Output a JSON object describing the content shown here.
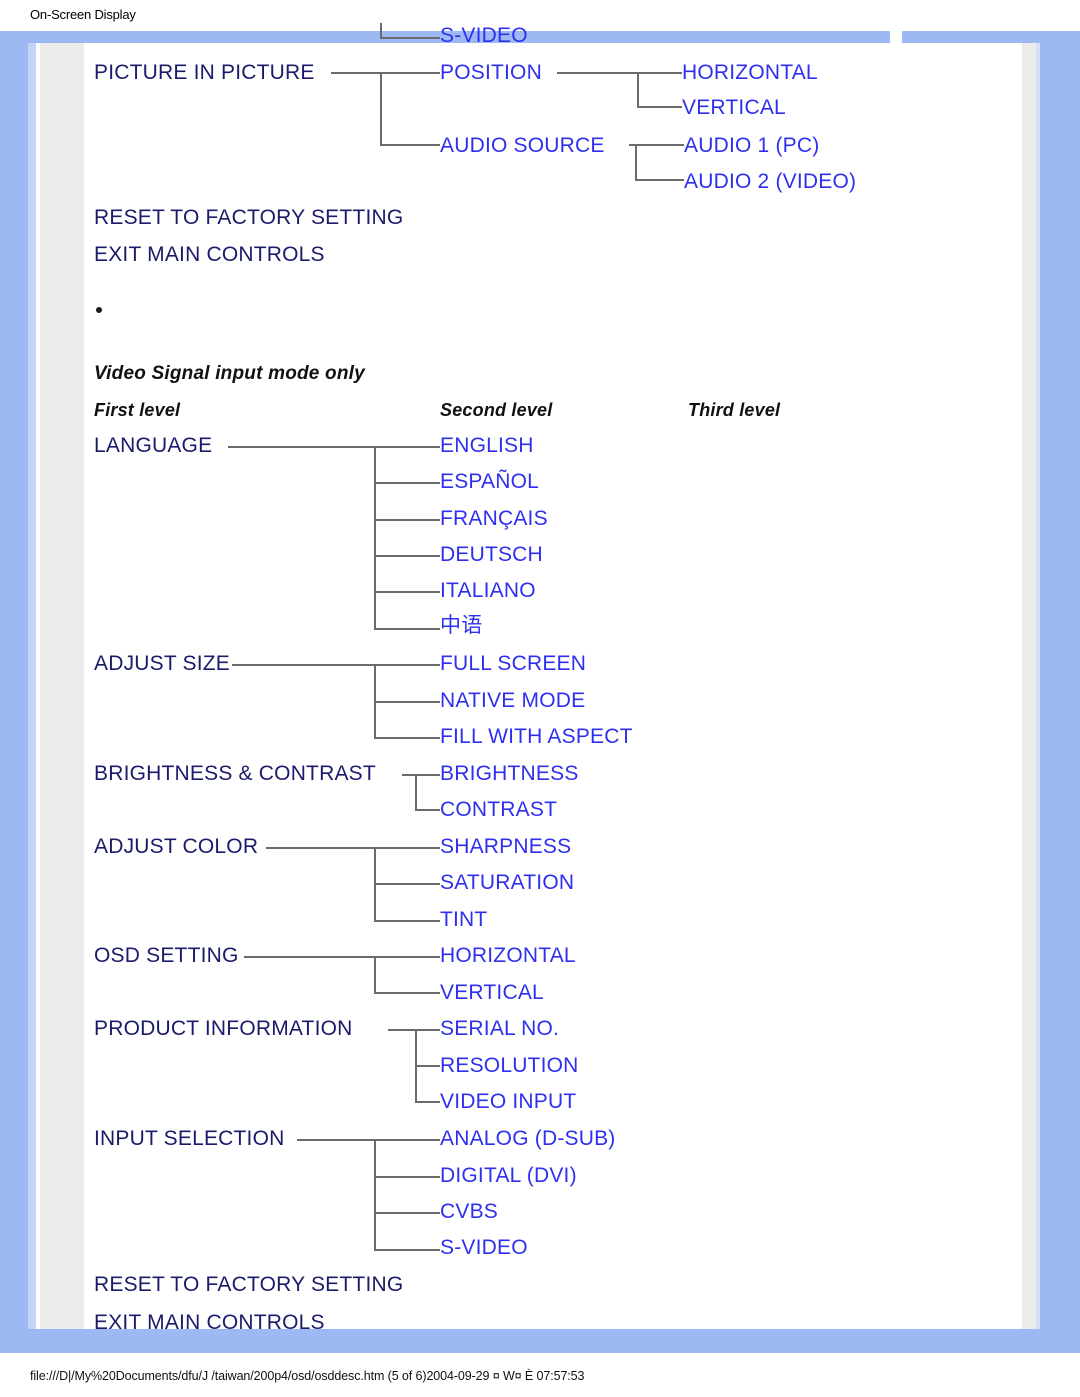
{
  "page": {
    "header_title": "On-Screen Display",
    "footer_text": "file:///D|/My%20Documents/dfu/J /taiwan/200p4/osd/osddesc.htm (5 of 6)2004-09-29 ¤ W¤ È 07:57:53",
    "colors": {
      "frame_blue": "#9db8f2",
      "frame_light_blue": "#c3d4f7",
      "frame_gray": "#ececec",
      "level1_text": "#1b1b6b",
      "level2_text": "#2f2ff0",
      "connector_line": "#6b6b6b",
      "background": "#ffffff"
    }
  },
  "top_section": {
    "orphan_third_level": "S-VIDEO",
    "first_level": "PICTURE IN PICTURE",
    "children": [
      {
        "label": "POSITION",
        "third_level": [
          "HORIZONTAL",
          "VERTICAL"
        ]
      },
      {
        "label": "AUDIO SOURCE",
        "third_level": [
          "AUDIO 1 (PC)",
          "AUDIO 2 (VIDEO)"
        ]
      }
    ],
    "trailing_items": [
      "RESET TO FACTORY SETTING",
      "EXIT MAIN CONTROLS"
    ]
  },
  "video_section": {
    "title": "Video Signal input mode only",
    "columns": {
      "first": "First level",
      "second": "Second level",
      "third": "Third level"
    },
    "groups": [
      {
        "first_level": "LANGUAGE",
        "second_level": [
          "ENGLISH",
          "ESPAÑOL",
          "FRANÇAIS",
          "DEUTSCH",
          "ITALIANO",
          "中语"
        ]
      },
      {
        "first_level": "ADJUST SIZE",
        "second_level": [
          "FULL SCREEN",
          "NATIVE MODE",
          "FILL WITH ASPECT"
        ]
      },
      {
        "first_level": "BRIGHTNESS & CONTRAST",
        "second_level": [
          "BRIGHTNESS",
          "CONTRAST"
        ]
      },
      {
        "first_level": "ADJUST COLOR",
        "second_level": [
          "SHARPNESS",
          "SATURATION",
          "TINT"
        ]
      },
      {
        "first_level": "OSD SETTING",
        "second_level": [
          "HORIZONTAL",
          "VERTICAL"
        ]
      },
      {
        "first_level": "PRODUCT INFORMATION",
        "second_level": [
          "SERIAL NO.",
          "RESOLUTION",
          "VIDEO INPUT"
        ]
      },
      {
        "first_level": "INPUT SELECTION",
        "second_level": [
          "ANALOG (D-SUB)",
          "DIGITAL (DVI)",
          "CVBS",
          "S-VIDEO"
        ]
      }
    ],
    "trailing_items": [
      "RESET TO FACTORY SETTING",
      "EXIT MAIN CONTROLS"
    ]
  }
}
